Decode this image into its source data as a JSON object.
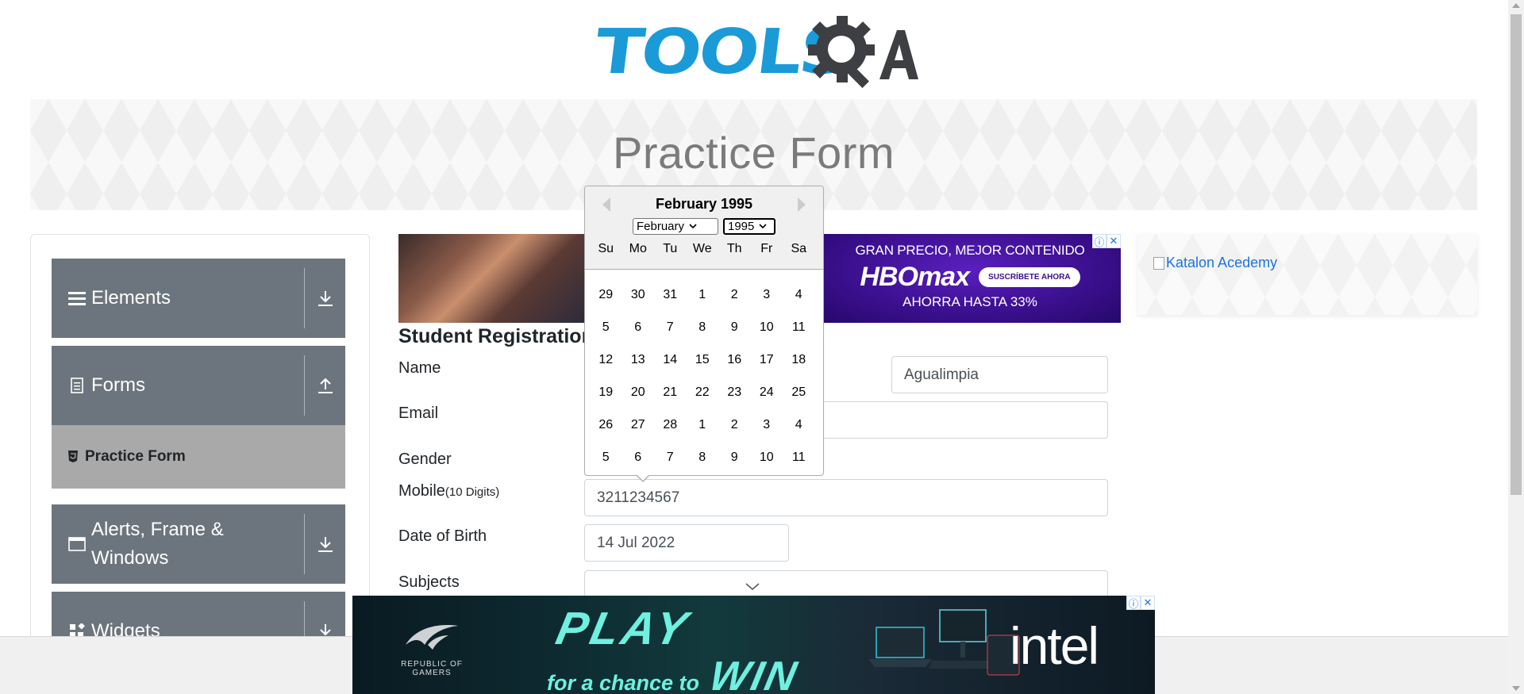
{
  "header": {
    "logo_text": "TOOLSQA"
  },
  "banner": {
    "title": "Practice Form"
  },
  "sidebar": {
    "groups": [
      {
        "label": "Elements",
        "icon": "hamburger-icon",
        "toggle": "download-icon"
      },
      {
        "label": "Forms",
        "icon": "document-icon",
        "toggle": "upload-icon"
      },
      {
        "label": "Alerts, Frame & Windows",
        "icon": "window-icon",
        "toggle": "download-icon"
      },
      {
        "label": "Widgets",
        "icon": "widgets-icon",
        "toggle": "download-icon"
      }
    ],
    "active_item": {
      "label": "Practice Form",
      "icon": "html5-icon"
    }
  },
  "ad_top": {
    "hbo_line1": "GRAN PRECIO, MEJOR CONTENIDO",
    "hbo_brand": "HBOmax",
    "hbo_cta": "SUSCRÍBETE AHORA",
    "hbo_line3": "AHORRA HASTA 33%"
  },
  "form": {
    "section_title": "Student Registration Form",
    "name_label": "Name",
    "last_name_value": "Agualimpia",
    "email_label": "Email",
    "gender_label": "Gender",
    "mobile_label": "Mobile",
    "mobile_hint": "(10 Digits)",
    "mobile_value": "3211234567",
    "dob_label": "Date of Birth",
    "dob_value": "14 Jul 2022",
    "subjects_label": "Subjects"
  },
  "datepicker": {
    "current_month": "February 1995",
    "month_select": "February",
    "year_select": "1995",
    "weekdays": [
      "Su",
      "Mo",
      "Tu",
      "We",
      "Th",
      "Fr",
      "Sa"
    ],
    "weeks": [
      [
        "29",
        "30",
        "31",
        "1",
        "2",
        "3",
        "4"
      ],
      [
        "5",
        "6",
        "7",
        "8",
        "9",
        "10",
        "11"
      ],
      [
        "12",
        "13",
        "14",
        "15",
        "16",
        "17",
        "18"
      ],
      [
        "19",
        "20",
        "21",
        "22",
        "23",
        "24",
        "25"
      ],
      [
        "26",
        "27",
        "28",
        "1",
        "2",
        "3",
        "4"
      ],
      [
        "5",
        "6",
        "7",
        "8",
        "9",
        "10",
        "11"
      ]
    ]
  },
  "right_ad": {
    "alt_text": "Katalon Acedemy"
  },
  "bottom_ad": {
    "rog_text": "REPUBLIC OF GAMERS",
    "play": "PLAY",
    "for_a_chance": "for a chance to",
    "win": "WIN",
    "brand": "intel"
  },
  "colors": {
    "accent": "#1a9bd7",
    "sidebar_bg": "#6c757d",
    "active_item_bg": "#a9a9a9"
  }
}
